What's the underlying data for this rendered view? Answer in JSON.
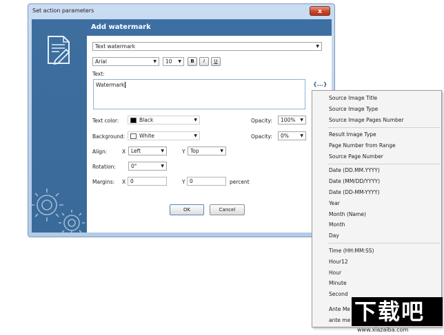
{
  "window": {
    "title": "Set action parameters",
    "close_glyph": "x",
    "header": "Add watermark"
  },
  "form": {
    "type_value": "Text watermark",
    "font_value": "Arial",
    "size_value": "10",
    "bold_label": "B",
    "italic_label": "I",
    "underline_label": "U",
    "text_label": "Text:",
    "text_value": "Watermark",
    "insert_glyph": "{...}",
    "text_color_label": "Text color:",
    "text_color_value": "Black",
    "text_color_hex": "#000000",
    "opacity_label": "Opacity:",
    "opacity_value": "100%",
    "background_label": "Background:",
    "background_value": "White",
    "background_hex": "#ffffff",
    "bg_opacity_label": "Opacity:",
    "bg_opacity_value": "0%",
    "align_label": "Align:",
    "align_x_label": "X",
    "align_x_value": "Left",
    "align_y_label": "Y",
    "align_y_value": "Top",
    "rotation_label": "Rotation:",
    "rotation_value": "0°",
    "margins_label": "Margins:",
    "margins_x_label": "X",
    "margins_x_value": "0",
    "margins_y_label": "Y",
    "margins_y_value": "0",
    "percent_label": "percent",
    "ok_label": "OK",
    "cancel_label": "Cancel"
  },
  "menu": {
    "groups": [
      [
        "Source Image Title",
        "Source Image Type",
        "Source Image Pages Number"
      ],
      [
        "Result Image Type",
        "Page Number from Range",
        "Source Page Number"
      ],
      [
        "Date (DD.MM.YYYY)",
        "Date (MM/DD/YYYY)",
        "Date (DD-MM-YYYY)",
        "Year",
        "Month (Name)",
        "Month",
        "Day"
      ],
      [
        "Time (HH:MM:SS)",
        "Hour12",
        "Hour",
        "Minute",
        "Second",
        "Ante Me",
        "ante me"
      ]
    ]
  },
  "watermark_text": {
    "logo": "下载吧",
    "url": "www.xiazaiba.com"
  },
  "colors": {
    "header_bg": "#3d6fa3",
    "sidebar_bg": "#3a6a99",
    "window_frame": "#b3cbe7",
    "close_button": "#c8472e"
  },
  "icons": [
    "document-edit-icon",
    "gears-icon",
    "close-icon",
    "insert-field-icon",
    "chevron-down-icon"
  ]
}
